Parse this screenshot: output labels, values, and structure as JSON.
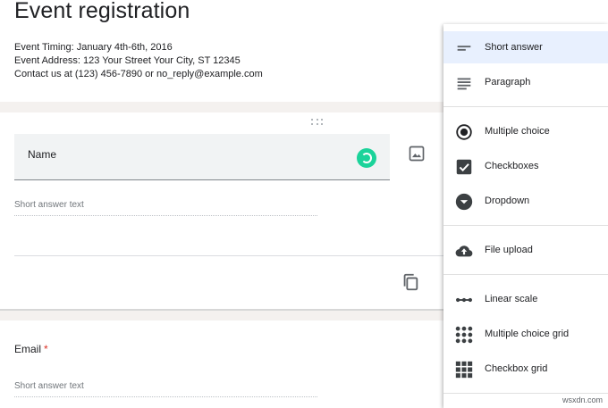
{
  "form": {
    "title": "Event registration",
    "description": [
      "Event Timing: January 4th-6th, 2016",
      "Event Address: 123 Your Street Your City, ST 12345",
      "Contact us at (123) 456-7890 or no_reply@example.com"
    ]
  },
  "question1": {
    "title": "Name",
    "answer_placeholder": "Short answer text"
  },
  "question2": {
    "title": "Email",
    "required_mark": "*",
    "answer_placeholder": "Short answer text"
  },
  "type_menu": {
    "selected": "Short answer",
    "items": [
      {
        "label": "Short answer",
        "icon": "short-answer-icon"
      },
      {
        "label": "Paragraph",
        "icon": "paragraph-icon"
      },
      {
        "label": "Multiple choice",
        "icon": "radio-icon"
      },
      {
        "label": "Checkboxes",
        "icon": "checkbox-icon"
      },
      {
        "label": "Dropdown",
        "icon": "dropdown-icon"
      },
      {
        "label": "File upload",
        "icon": "cloud-upload-icon"
      },
      {
        "label": "Linear scale",
        "icon": "linear-scale-icon"
      },
      {
        "label": "Multiple choice grid",
        "icon": "grid-dots-icon"
      },
      {
        "label": "Checkbox grid",
        "icon": "grid-squares-icon"
      }
    ]
  },
  "watermark": "wsxdn.com",
  "colors": {
    "accent": "#1bd39a",
    "selected_bg": "#e8f0fe",
    "required": "#d93025",
    "icon": "#5f6368"
  }
}
